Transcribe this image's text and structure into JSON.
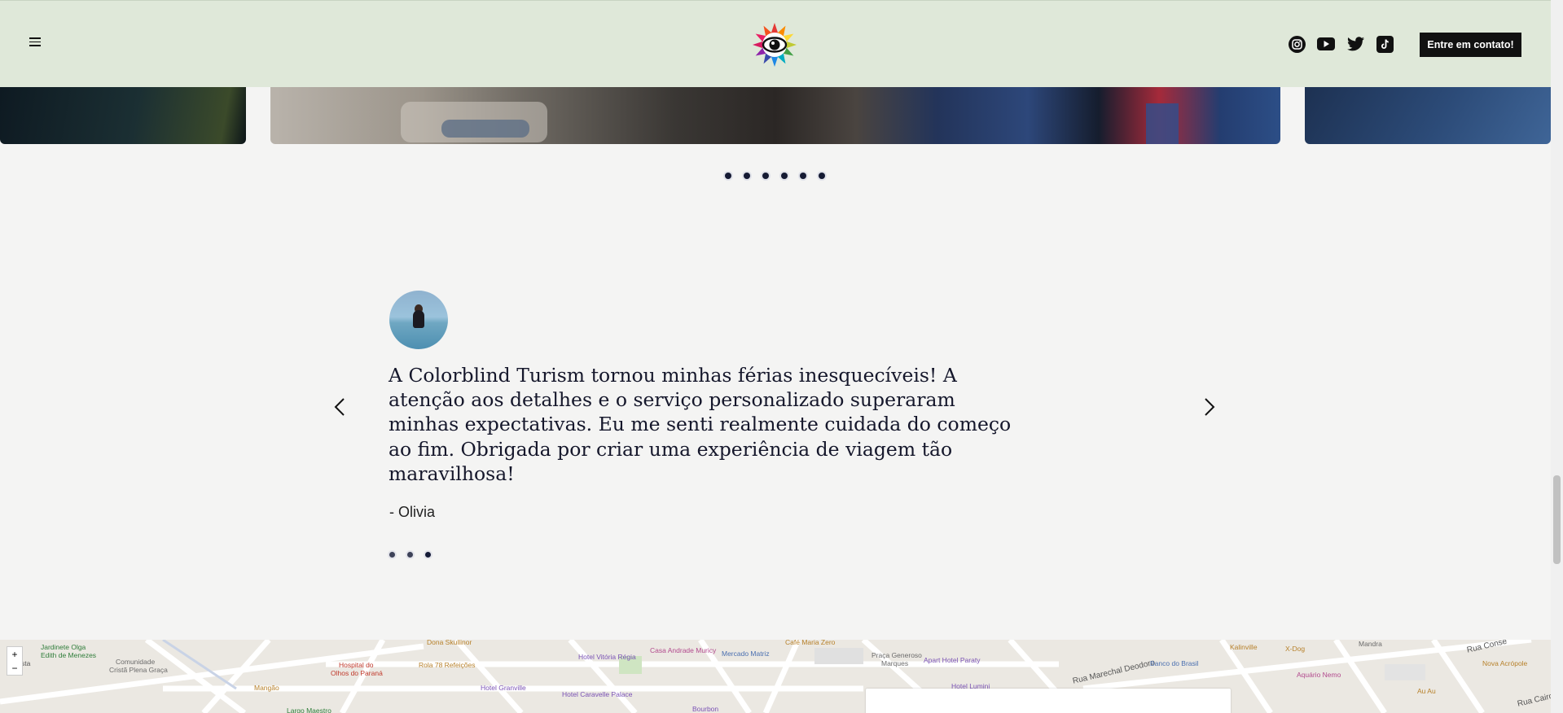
{
  "header": {
    "menu_icon": "hamburger-menu-icon",
    "logo_icon": "colorful-eye-flower-logo-icon",
    "socials": [
      {
        "name": "instagram-icon"
      },
      {
        "name": "youtube-icon"
      },
      {
        "name": "twitter-icon"
      },
      {
        "name": "tiktok-icon"
      }
    ],
    "cta_label": "Entre em contato!"
  },
  "gallery": {
    "dots": 6
  },
  "testimonial": {
    "quote": "A Colorblind Turism tornou minhas férias inesquecíveis! A atenção aos detalhes e o serviço personalizado superaram minhas expectativas. Eu me senti realmente cuidada do começo ao fim. Obrigada por criar uma experiência de viagem tão maravilhosa!",
    "author": "- Olivia",
    "dots": 3,
    "active_dot": 3
  },
  "map": {
    "zoom_in": "+",
    "zoom_out": "−",
    "labels": [
      {
        "text": "Jardinete Olga",
        "color": "#2f7d3a"
      },
      {
        "text": "Edith de Menezes",
        "color": "#2f7d3a"
      },
      {
        "text": "Comunidade",
        "color": "#6b6b6b"
      },
      {
        "text": "Cristã Plena Graça",
        "color": "#6b6b6b"
      },
      {
        "text": "Hospital do",
        "color": "#c0392b"
      },
      {
        "text": "Olhos do Paraná",
        "color": "#c0392b"
      },
      {
        "text": "Rola 78 Refeições",
        "color": "#b7812b"
      },
      {
        "text": "Dona Skullinor",
        "color": "#b7812b"
      },
      {
        "text": "Hotel Vitória Régia",
        "color": "#7a52b5"
      },
      {
        "text": "Casa Andrade Muricy",
        "color": "#b24a8e"
      },
      {
        "text": "Mercado Matriz",
        "color": "#4a6fb0"
      },
      {
        "text": "Café Maria Zero",
        "color": "#b7812b"
      },
      {
        "text": "Praça Generoso",
        "color": "#6b6b6b"
      },
      {
        "text": "Marques",
        "color": "#6b6b6b"
      },
      {
        "text": "Apart Hotel Paraty",
        "color": "#7a52b5"
      },
      {
        "text": "Hotel Granville",
        "color": "#7a52b5"
      },
      {
        "text": "Hotel Caravelle Palace",
        "color": "#7a52b5"
      },
      {
        "text": "Mangão",
        "color": "#b7812b"
      },
      {
        "text": "Largo Maestro",
        "color": "#2f7d3a"
      },
      {
        "text": "Bourbon",
        "color": "#7a52b5"
      },
      {
        "text": "Rua Marechal Deodoro",
        "color": "#555555"
      },
      {
        "text": "Banco do Brasil",
        "color": "#4a6fb0"
      },
      {
        "text": "Kalinville",
        "color": "#b7812b"
      },
      {
        "text": "X-Dog",
        "color": "#b7812b"
      },
      {
        "text": "Mandra",
        "color": "#6b6b6b"
      },
      {
        "text": "Aquário Nemo",
        "color": "#b24a8e"
      },
      {
        "text": "Nova Acrópole",
        "color": "#b7812b"
      },
      {
        "text": "Au Au",
        "color": "#b7812b"
      },
      {
        "text": "Rua Conse",
        "color": "#555555"
      },
      {
        "text": "Hotel Lumini",
        "color": "#7a52b5"
      },
      {
        "text": "Rua Cairo",
        "color": "#555555"
      },
      {
        "text": "sta",
        "color": "#555555"
      }
    ]
  }
}
